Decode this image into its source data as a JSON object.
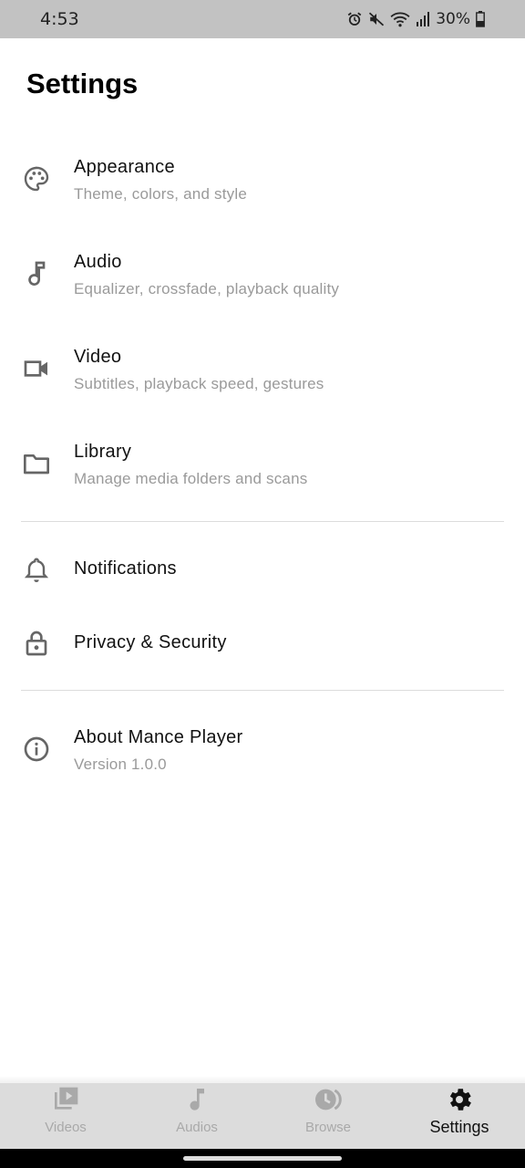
{
  "status_bar": {
    "time": "4:53",
    "battery": "30%",
    "icons": [
      "alarm-icon",
      "mute-icon",
      "wifi-icon",
      "signal-icon",
      "battery-icon"
    ]
  },
  "page": {
    "title": "Settings"
  },
  "settings": {
    "appearance": {
      "title": "Appearance",
      "subtitle": "Theme, colors, and style",
      "icon": "palette-icon"
    },
    "audio": {
      "title": "Audio",
      "subtitle": "Equalizer, crossfade, playback quality",
      "icon": "music-note-icon"
    },
    "video": {
      "title": "Video",
      "subtitle": "Subtitles, playback speed, gestures",
      "icon": "videocam-icon"
    },
    "library": {
      "title": "Library",
      "subtitle": "Manage media folders and scans",
      "icon": "folder-icon"
    },
    "notifications": {
      "title": "Notifications",
      "icon": "bell-icon"
    },
    "privacy": {
      "title": "Privacy & Security",
      "icon": "lock-icon"
    },
    "about": {
      "title": "About Mance Player",
      "subtitle": "Version 1.0.0",
      "icon": "info-icon"
    }
  },
  "bottom_nav": {
    "items": [
      {
        "label": "Videos",
        "icon": "video-library-icon",
        "active": false
      },
      {
        "label": "Audios",
        "icon": "music-note-icon",
        "active": false
      },
      {
        "label": "Browse",
        "icon": "history-icon",
        "active": false
      },
      {
        "label": "Settings",
        "icon": "gear-icon",
        "active": true
      }
    ]
  },
  "colors": {
    "status_bar_bg": "#c2c2c2",
    "icon_gray": "#666666",
    "subtitle_gray": "#9a9a9a",
    "nav_bg": "#dcdcdc",
    "nav_inactive": "#a9a9a9"
  }
}
